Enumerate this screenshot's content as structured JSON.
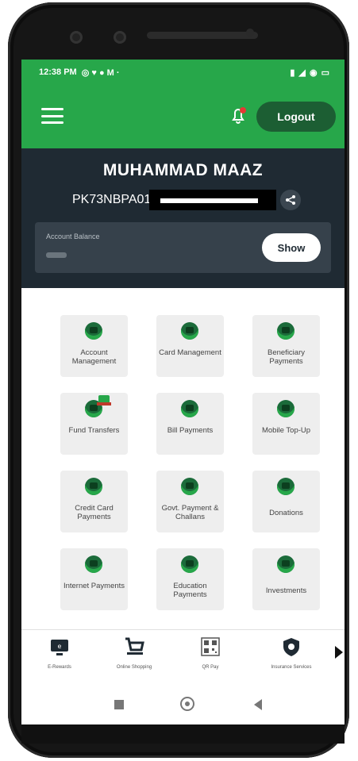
{
  "status_bar": {
    "time": "12:38 PM",
    "left_icons": "◎ ♥ ● M ·",
    "right_icons": "▮ ◢ ◉ ▭"
  },
  "app_bar": {
    "logout_label": "Logout"
  },
  "account": {
    "name": "MUHAMMAD MAAZ",
    "iban_prefix": "PK73NBPA01",
    "balance_label": "Account Balance",
    "show_label": "Show"
  },
  "services": [
    {
      "label": "Account Management",
      "icon": "account-icon"
    },
    {
      "label": "Card Management",
      "icon": "card-icon"
    },
    {
      "label": "Beneficiary Payments",
      "icon": "beneficiary-icon"
    },
    {
      "label": "Fund Transfers",
      "icon": "fund-transfer-icon"
    },
    {
      "label": "Bill Payments",
      "icon": "bill-icon"
    },
    {
      "label": "Mobile Top-Up",
      "icon": "mobile-icon"
    },
    {
      "label": "Credit Card Payments",
      "icon": "credit-card-icon"
    },
    {
      "label": "Govt. Payment & Challans",
      "icon": "govt-icon"
    },
    {
      "label": "Donations",
      "icon": "donation-icon"
    },
    {
      "label": "Internet Payments",
      "icon": "internet-icon"
    },
    {
      "label": "Education Payments",
      "icon": "education-icon"
    },
    {
      "label": "Investments",
      "icon": "investment-icon"
    }
  ],
  "bottom_nav": [
    {
      "label": "E-Rewards",
      "icon": "rewards-icon"
    },
    {
      "label": "Online Shopping",
      "icon": "cart-icon"
    },
    {
      "label": "QR Pay",
      "icon": "qr-icon"
    },
    {
      "label": "Insurance Services",
      "icon": "shield-icon"
    }
  ],
  "colors": {
    "brand_green": "#27a74a",
    "dark_green": "#1c5e33",
    "header_dark": "#1f2a33"
  }
}
